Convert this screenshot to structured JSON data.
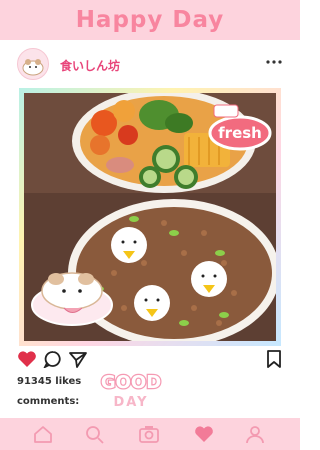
{
  "header": {
    "title": "Happy Day"
  },
  "post": {
    "username": "食いしん坊",
    "stickers": {
      "fresh": "fresh",
      "good": "GOOD",
      "day": "DAY"
    },
    "likes": "91345 likes",
    "comments_label": "comments:"
  },
  "icons": {
    "more": "more-dots-icon",
    "like": "heart-filled-icon",
    "comment": "comment-bubble-icon",
    "share": "send-arrow-icon",
    "save": "bookmark-icon",
    "nav": [
      "home-icon",
      "search-icon",
      "camera-icon",
      "heart-icon",
      "profile-icon"
    ]
  },
  "colors": {
    "header_bg": "#fdd3dd",
    "title": "#f8859f",
    "username": "#e8457a",
    "like_red": "#e0304a",
    "nav_icon": "#f39ab1",
    "nav_active": "#f27b98"
  }
}
